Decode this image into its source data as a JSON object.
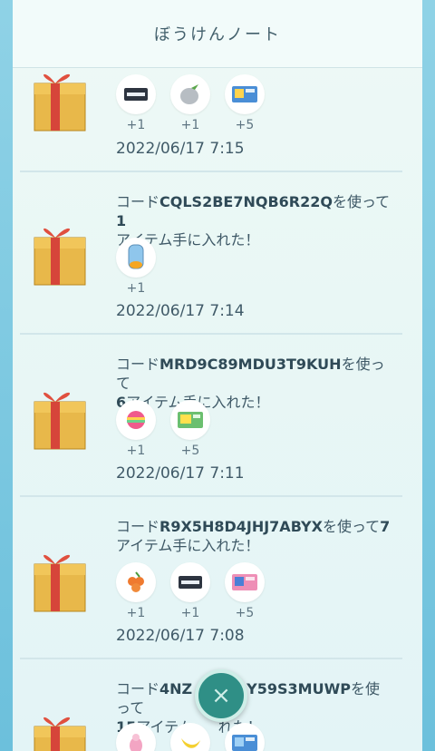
{
  "header": {
    "title": "ぼうけんノート"
  },
  "entries": [
    {
      "text_pre": "",
      "code": "",
      "text_mid": "",
      "count": "",
      "text_post": "",
      "items": [
        {
          "icon": "ticket-icon",
          "qty": "+1"
        },
        {
          "icon": "berry-icon",
          "qty": "+1"
        },
        {
          "icon": "card-icon",
          "qty": "+5"
        }
      ],
      "date": "2022/06/17 7:15"
    },
    {
      "text_pre": "コード",
      "code": "CQLS2BE7NQB6R22Q",
      "text_mid": "を使って",
      "count": "1",
      "text_post": "アイテム手に入れた！",
      "items": [
        {
          "icon": "incubator-icon",
          "qty": "+1"
        }
      ],
      "date": "2022/06/17 7:14"
    },
    {
      "text_pre": "コード",
      "code": "MRD9C89MDU3T9KUH",
      "text_mid": "を使って",
      "count": "6",
      "text_post": "アイテム手に入れた！",
      "items": [
        {
          "icon": "rainbow-lure-icon",
          "qty": "+1"
        },
        {
          "icon": "card-icon",
          "qty": "+5"
        }
      ],
      "date": "2022/06/17 7:11"
    },
    {
      "text_pre": "コード",
      "code": "R9X5H8D4JHJ7ABYX",
      "text_mid": "を使って",
      "count": "7",
      "text_post": "アイテム手に入れた！",
      "items": [
        {
          "icon": "grapes-icon",
          "qty": "+1"
        },
        {
          "icon": "ticket-icon",
          "qty": "+1"
        },
        {
          "icon": "card-icon",
          "qty": "+5"
        }
      ],
      "date": "2022/06/17 7:08"
    },
    {
      "text_pre": "コード",
      "code": "4NZ",
      "code_tail": "Y59S3MUWP",
      "text_mid": "を使って",
      "count": "15",
      "text_post": "アイテム",
      "text_post2": "れた！",
      "items": [
        {
          "icon": "bird-icon",
          "qty": ""
        },
        {
          "icon": "banana-icon",
          "qty": ""
        },
        {
          "icon": "card-icon",
          "qty": ""
        }
      ],
      "date": ""
    }
  ],
  "close_button": {
    "label": "×"
  }
}
